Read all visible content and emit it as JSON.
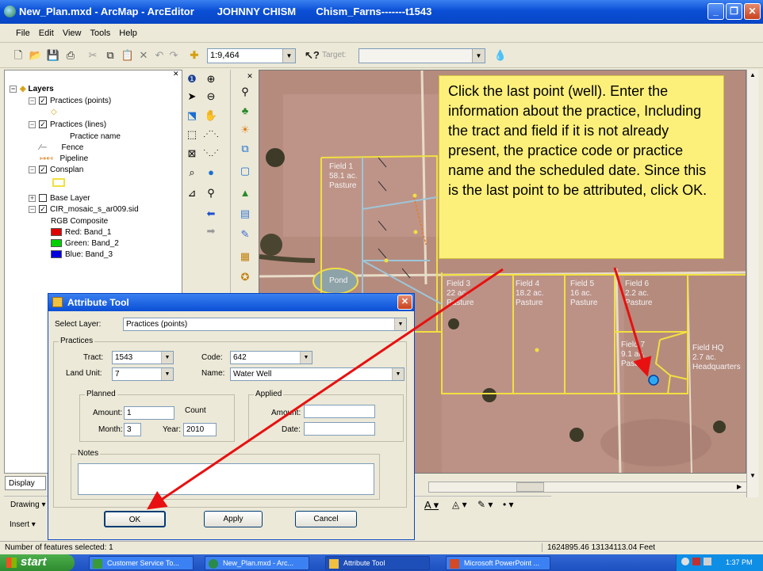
{
  "window": {
    "title": "New_Plan.mxd - ArcMap - ArcEditor        JOHNNY CHISM       Chism_Farns-------t1543"
  },
  "menu": [
    "File",
    "Edit",
    "View",
    "Tools",
    "Help"
  ],
  "toolbar": {
    "scale": "1:9,464",
    "target_label": "Target:"
  },
  "toc": {
    "root": "Layers",
    "items": [
      {
        "label": "Practices (points)",
        "checked": true
      },
      {
        "label": "Practices (lines)",
        "checked": true
      },
      {
        "label": "Practice name",
        "checked": false
      },
      {
        "label": "Fence",
        "checked": false
      },
      {
        "label": "Pipeline",
        "checked": false
      },
      {
        "label": "Consplan",
        "checked": true
      },
      {
        "label": "Base Layer",
        "checked": false
      },
      {
        "label": "CIR_mosaic_s_ar009.sid",
        "checked": true
      },
      {
        "label": "RGB Composite",
        "checked": false
      },
      {
        "label": "Red:   Band_1",
        "color": "#e00000"
      },
      {
        "label": "Green: Band_2",
        "color": "#00d000"
      },
      {
        "label": "Blue:   Band_3",
        "color": "#0000e0"
      }
    ],
    "tab_display": "Display"
  },
  "map": {
    "fields": [
      {
        "lines": [
          "Field  1",
          "58.1 ac.",
          "Pasture"
        ]
      },
      {
        "lines": [
          "Field  3",
          "22  ac.",
          "Pasture"
        ]
      },
      {
        "lines": [
          "Field  4",
          "18.2 ac.",
          "Pasture"
        ]
      },
      {
        "lines": [
          "Field  5",
          "16 ac.",
          "Pasture"
        ]
      },
      {
        "lines": [
          "Field  6",
          "2.2 ac.",
          "Pasture"
        ]
      },
      {
        "lines": [
          "Field  7",
          "9.1 ac.",
          "Pasture"
        ]
      },
      {
        "lines": [
          "Field  HQ",
          "2.7 ac.",
          "Headquarters"
        ]
      }
    ],
    "pond": "Pond"
  },
  "callout": {
    "text": "Click the last  point (well). Enter the information about the practice, Including the tract and field if it is not already present, the practice code or practice name and the scheduled date. Since this is the last point to be attributed, click OK."
  },
  "dialog": {
    "title": "Attribute Tool",
    "select_layer_label": "Select Layer:",
    "select_layer_value": "Practices (points)",
    "practices_group": "Practices",
    "tract_label": "Tract:",
    "tract_value": "1543",
    "code_label": "Code:",
    "code_value": "642",
    "land_unit_label": "Land Unit:",
    "land_unit_value": "7",
    "name_label": "Name:",
    "name_value": "Water Well",
    "planned_group": "Planned",
    "amount_label": "Amount:",
    "amount_value": "1",
    "count_label": "Count",
    "month_label": "Month:",
    "month_value": "3",
    "year_label": "Year:",
    "year_value": "2010",
    "applied_group": "Applied",
    "applied_amount_label": "Amount:",
    "date_label": "Date:",
    "notes_group": "Notes",
    "ok": "OK",
    "apply": "Apply",
    "cancel": "Cancel"
  },
  "bottom": {
    "drawing": "Drawing",
    "insert": "Insert"
  },
  "status": {
    "selected": "Number of features selected: 1",
    "coords": "1624895.46  13134113.04 Feet"
  },
  "taskbar": {
    "start": "start",
    "tasks": [
      "Customer Service To...",
      "New_Plan.mxd - Arc...",
      "Attribute Tool",
      "Microsoft PowerPoint ..."
    ],
    "clock": "1:37 PM"
  }
}
